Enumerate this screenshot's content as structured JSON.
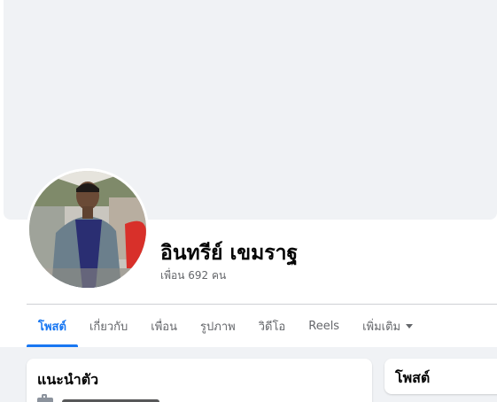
{
  "profile": {
    "name": "อินทรีย์ เขมราฐ",
    "friends": "เพื่อน 692 คน"
  },
  "tabs": [
    {
      "label": "โพสต์",
      "active": true
    },
    {
      "label": "เกี่ยวกับ",
      "active": false
    },
    {
      "label": "เพื่อน",
      "active": false
    },
    {
      "label": "รูปภาพ",
      "active": false
    },
    {
      "label": "วิดีโอ",
      "active": false
    },
    {
      "label": "Reels",
      "active": false
    },
    {
      "label": "เพิ่มเติม",
      "active": false
    }
  ],
  "intro_card": {
    "title": "แนะนำตัว"
  },
  "posts_card": {
    "title": "โพสต์"
  },
  "colors": {
    "accent": "#1877f2",
    "background": "#f0f2f5",
    "text_primary": "#050505",
    "text_secondary": "#65676b"
  },
  "icons": {
    "more_tab": "caret-down-icon",
    "intro_item": "briefcase-icon"
  }
}
